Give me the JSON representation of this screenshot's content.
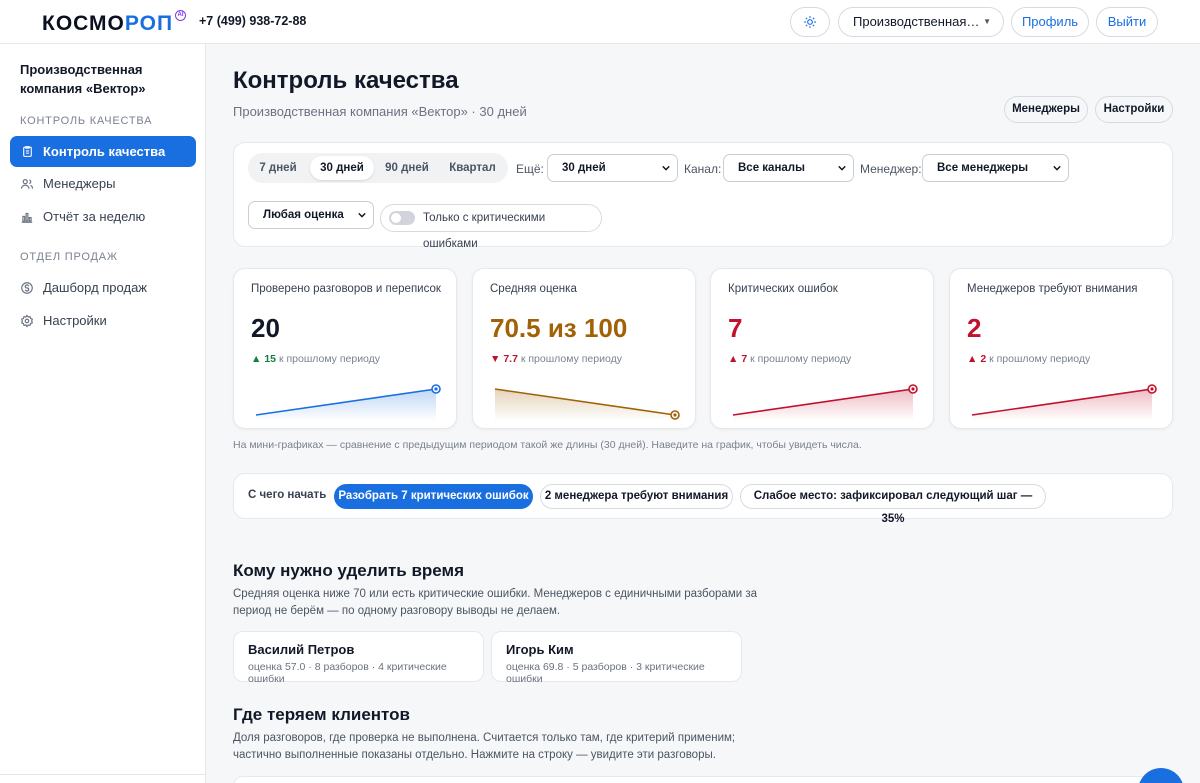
{
  "header": {
    "logo_part1": "КОСМО",
    "logo_part2": "РОП",
    "logo_badge": "AI",
    "phone": "+7 (499) 938-72-88",
    "company_selector": "Производственная к...",
    "profile_label": "Профиль",
    "logout_label": "Выйти",
    "theme_icon": "sun-icon"
  },
  "sidebar": {
    "company": "Производственная компания «Вектор»",
    "section1": "Контроль качества",
    "section2": "Отдел продаж",
    "items": [
      {
        "label": "Контроль качества",
        "icon": "clipboard-icon",
        "active": true
      },
      {
        "label": "Менеджеры",
        "icon": "users-icon"
      },
      {
        "label": "Отчёт за неделю",
        "icon": "chart-icon"
      },
      {
        "label": "Дашборд продаж",
        "icon": "coin-icon"
      },
      {
        "label": "Настройки",
        "icon": "gear-icon"
      }
    ]
  },
  "page": {
    "title": "Контроль качества",
    "subtitle": "Производственная компания «Вектор» · 30 дней",
    "btn_managers": "Менеджеры",
    "btn_settings": "Настройки"
  },
  "filters": {
    "periods": [
      "7 дней",
      "30 дней",
      "90 дней",
      "Квартал"
    ],
    "selected_period": "30 дней",
    "more_label": "Ещё:",
    "more_value": "30 дней",
    "channel_label": "Канал:",
    "channel_value": "Все каналы",
    "manager_label": "Менеджер:",
    "manager_value": "Все менеджеры",
    "score_value": "Любая оценка",
    "critical_toggle_label": "Только с критическими ошибками",
    "critical_toggle_on": false
  },
  "kpis": [
    {
      "label": "Проверено разговоров и переписок",
      "value": "20",
      "delta_arrow": "▲",
      "delta": "15",
      "delta_suffix": "к прошлому периоду",
      "color": "#1a6fe0",
      "delta_color": "#15803d",
      "spark_prev": 5,
      "spark_cur": 20
    },
    {
      "label": "Средняя оценка",
      "value": "70.5 из 100",
      "delta_arrow": "▼",
      "delta": "7.7",
      "delta_suffix": "к прошлому периоду",
      "color": "#a16207",
      "delta_color": "#c0122c",
      "spark_prev": 78.2,
      "spark_cur": 70.5
    },
    {
      "label": "Критических ошибок",
      "value": "7",
      "delta_arrow": "▲",
      "delta": "7",
      "delta_suffix": "к прошлому периоду",
      "color": "#c0122c",
      "delta_color": "#c0122c",
      "spark_prev": 0,
      "spark_cur": 7
    },
    {
      "label": "Менеджеров требуют внимания",
      "value": "2",
      "delta_arrow": "▲",
      "delta": "2",
      "delta_suffix": "к прошлому периоду",
      "color": "#c0122c",
      "delta_color": "#c0122c",
      "spark_prev": 0,
      "spark_cur": 2
    }
  ],
  "kpi_note": "На мини-графиках — сравнение с предыдущим периодом такой же длины (30 дней). Наведите на график, чтобы увидеть числа.",
  "start": {
    "label": "С чего начать",
    "chips": [
      "Разобрать 7 критических ошибок",
      "2 менеджера требуют внимания",
      "Слабое место: зафиксировал следующий шаг — 35%"
    ]
  },
  "attention": {
    "title": "Кому нужно уделить время",
    "desc": "Средняя оценка ниже 70 или есть критические ошибки. Менеджеров с единичными разборами за период не берём — по одному разговору выводы не делаем.",
    "managers": [
      {
        "name": "Василий Петров",
        "meta": "оценка 57.0 · 8 разборов · 4 критические ошибки"
      },
      {
        "name": "Игорь Ким",
        "meta": "оценка 69.8 · 5 разборов · 3 критические ошибки"
      }
    ]
  },
  "losses": {
    "title": "Где теряем клиентов",
    "desc": "Доля разговоров, где проверка не выполнена. Считается только там, где критерий применим; частично выполненные показаны отдельно. Нажмите на строку — увидите эти разговоры."
  }
}
